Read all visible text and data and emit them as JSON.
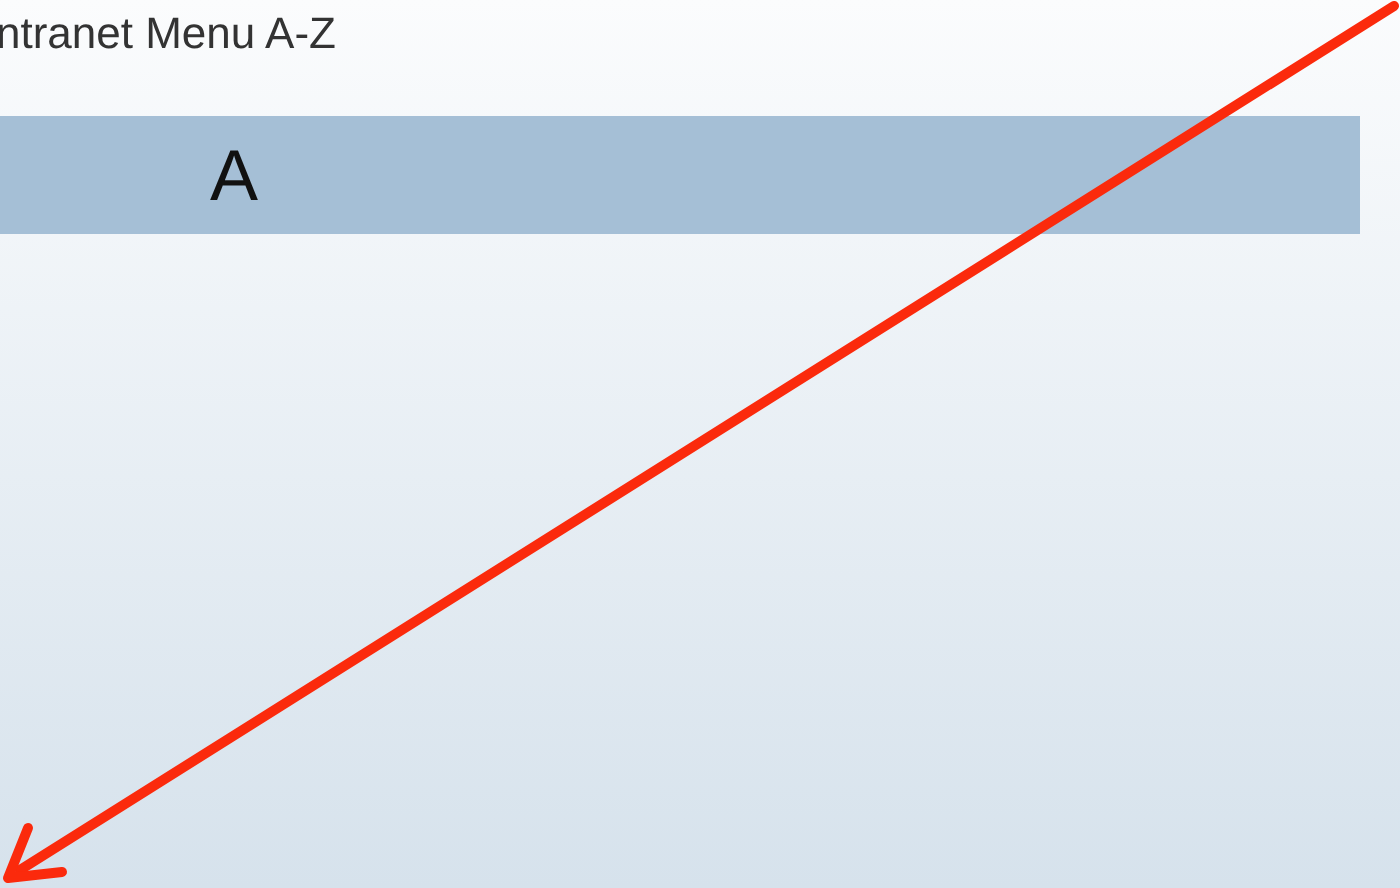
{
  "heading": "ntranet Menu A-Z",
  "letter_bar": {
    "letter": "A"
  }
}
